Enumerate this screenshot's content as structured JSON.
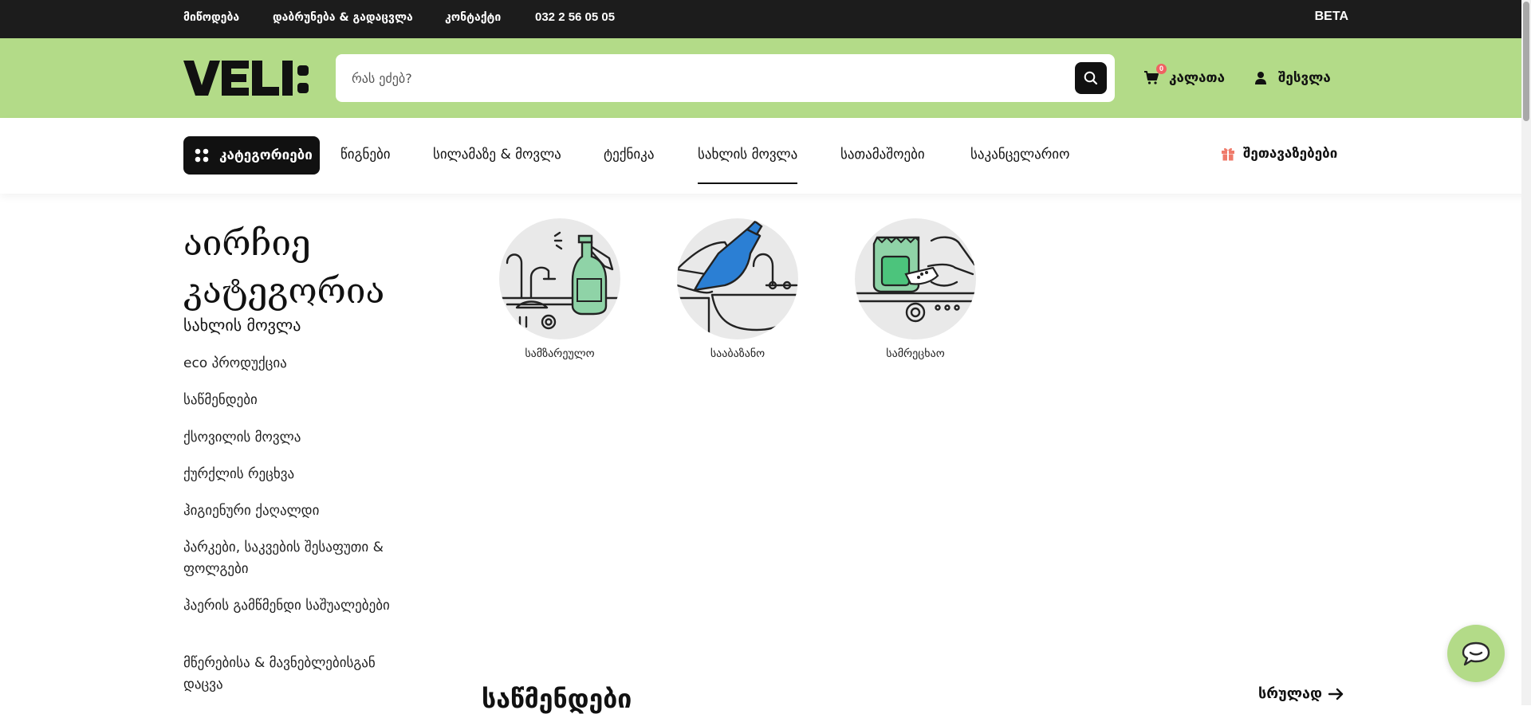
{
  "topbar": {
    "links": [
      "მიწოდება",
      "დაბრუნება & გადაცვლა",
      "კონტაქტი",
      "032 2 56 05 05"
    ],
    "beta": "BETA"
  },
  "header": {
    "logo_text": "VELI:",
    "search_placeholder": "რას ეძებ?",
    "cart_label": "კალათა",
    "cart_count": "0",
    "login_label": "შესვლა",
    "brand_color": "#b3db88"
  },
  "nav": {
    "categories_button": "კატეგორიები",
    "items": [
      "წიგნები",
      "სილამაზე & მოვლა",
      "ტექნიკა",
      "სახლის მოვლა",
      "სათამაშოები",
      "საკანცელარიო"
    ],
    "active_item": "სახლის მოვლა",
    "offers_label": "შეთავაზებები"
  },
  "sidebar": {
    "title": "აირჩიე კატეგორია",
    "subtitle": "სახლის მოვლა",
    "items": [
      "eco პროდუქცია",
      "საწმენდები",
      "ქსოვილის მოვლა",
      "ქურქლის რეცხვა",
      "ჰიგიენური ქაღალდი",
      "პარკები, საკვების შესაფუთი & ფოლგები",
      "ჰაერის გამწმენდი საშუალებები",
      "მწერებისა & მავნებლებისგან დაცვა"
    ]
  },
  "subcategories": [
    {
      "label": "სამზარეულო",
      "icon": "kitchen-spray-icon"
    },
    {
      "label": "სააბაზანო",
      "icon": "bathroom-cleaner-icon"
    },
    {
      "label": "სამრეცხაო",
      "icon": "laundry-detergent-icon"
    }
  ],
  "section": {
    "title": "საწმენდები",
    "see_all": "სრულად"
  }
}
